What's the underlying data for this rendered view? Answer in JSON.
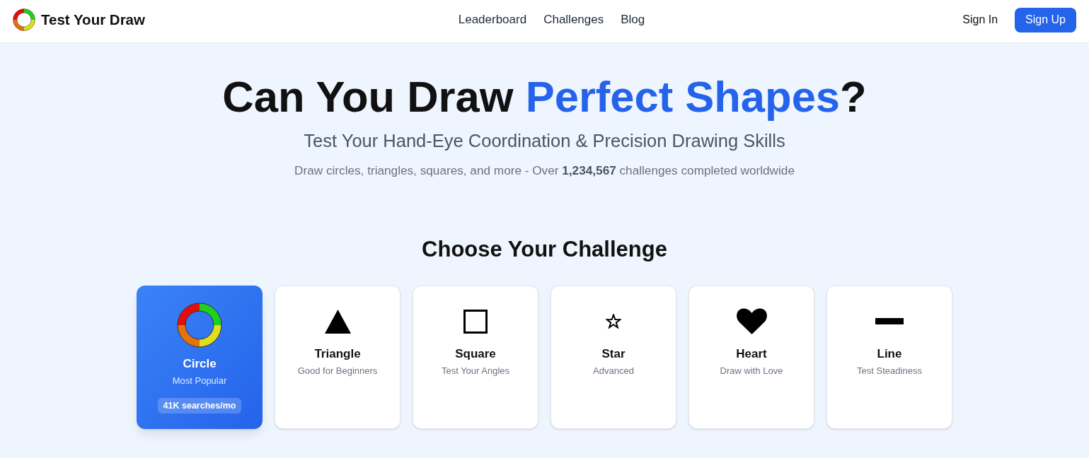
{
  "header": {
    "brand": "Test Your Draw",
    "nav": [
      "Leaderboard",
      "Challenges",
      "Blog"
    ],
    "sign_in": "Sign In",
    "sign_up": "Sign Up"
  },
  "hero": {
    "headline": [
      {
        "text": "Can You Draw ",
        "highlight": false
      },
      {
        "text": "Perfect Shapes",
        "highlight": true
      },
      {
        "text": "?",
        "highlight": false
      }
    ],
    "subtitle": "Test Your Hand-Eye Coordination & Precision Drawing Skills",
    "stats": "Draw circles, triangles, squares, and more - Over **1,234,567** challenges completed worldwide"
  },
  "challenges": {
    "heading": "Choose Your Challenge",
    "cards": [
      {
        "kind": "ring",
        "title": "Circle",
        "subtitle": "Most Popular",
        "badge": "41K searches/mo",
        "selected": true
      },
      {
        "kind": "triangle",
        "title": "Triangle",
        "subtitle": "Good for Beginners",
        "selected": false
      },
      {
        "kind": "square",
        "title": "Square",
        "subtitle": "Test Your Angles",
        "selected": false
      },
      {
        "kind": "star",
        "title": "Star",
        "subtitle": "Advanced",
        "selected": false
      },
      {
        "kind": "heart",
        "title": "Heart",
        "subtitle": "Draw with Love",
        "selected": false
      },
      {
        "kind": "line",
        "title": "Line",
        "subtitle": "Test Steadiness",
        "selected": false
      }
    ]
  }
}
